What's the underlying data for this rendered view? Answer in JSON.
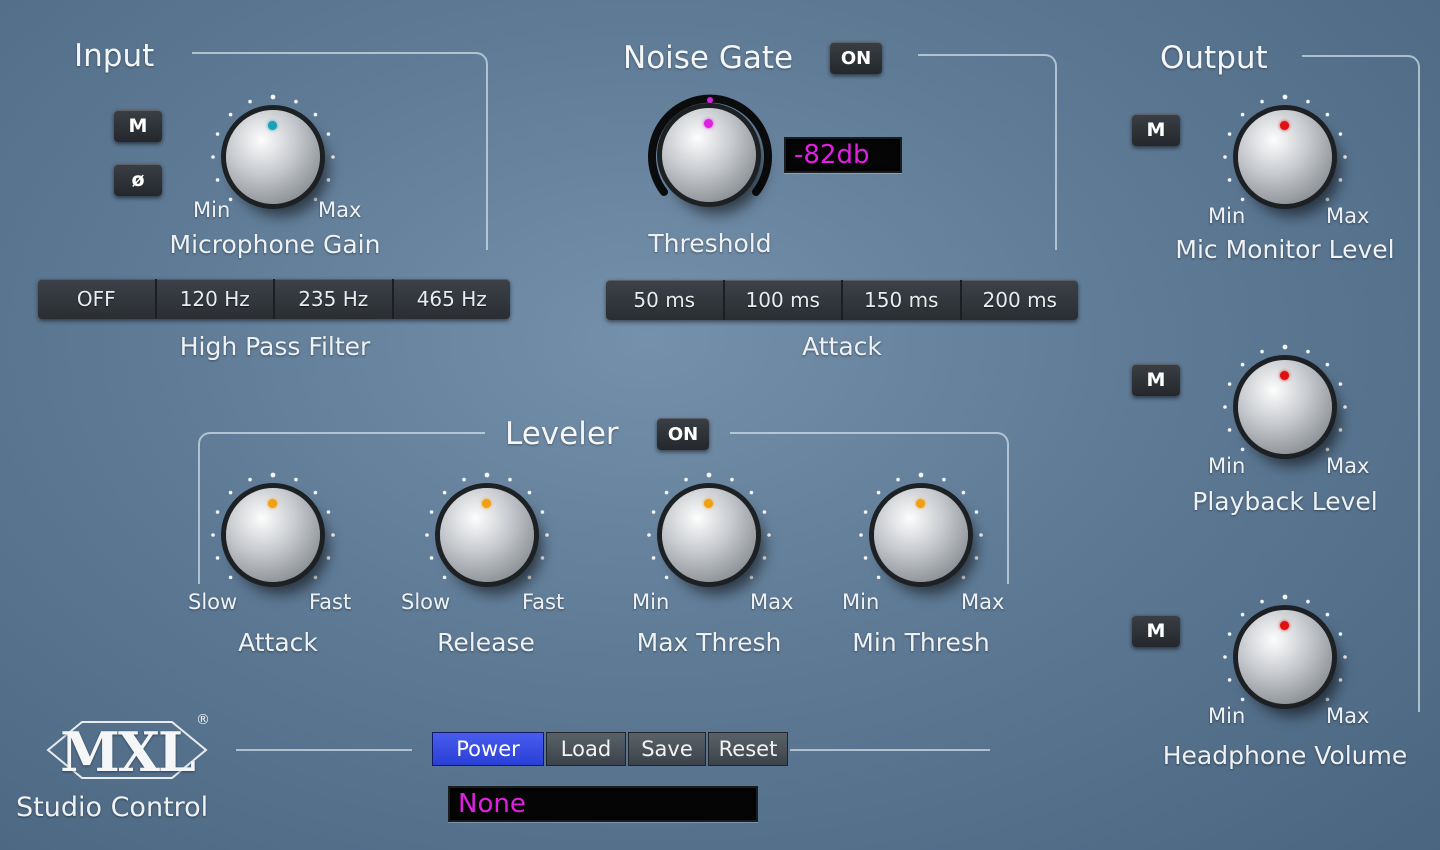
{
  "input": {
    "title": "Input",
    "mute_label": "M",
    "phase_label": "ø",
    "gain": {
      "min_label": "Min",
      "max_label": "Max",
      "label": "Microphone Gain",
      "dot_color": "#1aa0b8"
    },
    "hpf": {
      "options": [
        "OFF",
        "120 Hz",
        "235 Hz",
        "465 Hz"
      ],
      "label": "High Pass Filter"
    }
  },
  "noise_gate": {
    "title": "Noise Gate",
    "on_label": "ON",
    "threshold": {
      "label": "Threshold",
      "value": "-82db",
      "dot_color": "#e020e0"
    },
    "attack": {
      "options": [
        "50 ms",
        "100 ms",
        "150 ms",
        "200 ms"
      ],
      "label": "Attack"
    }
  },
  "output": {
    "title": "Output",
    "mute_label": "M",
    "knobs": [
      {
        "min_label": "Min",
        "max_label": "Max",
        "label": "Mic Monitor Level",
        "dot_color": "#e01010"
      },
      {
        "min_label": "Min",
        "max_label": "Max",
        "label": "Playback Level",
        "dot_color": "#e01010"
      },
      {
        "min_label": "Min",
        "max_label": "Max",
        "label": "Headphone Volume",
        "dot_color": "#e01010"
      }
    ]
  },
  "leveler": {
    "title": "Leveler",
    "on_label": "ON",
    "knobs": [
      {
        "min_label": "Slow",
        "max_label": "Fast",
        "label": "Attack",
        "dot_color": "#f0a010"
      },
      {
        "min_label": "Slow",
        "max_label": "Fast",
        "label": "Release",
        "dot_color": "#f0a010"
      },
      {
        "min_label": "Min",
        "max_label": "Max",
        "label": "Max Thresh",
        "dot_color": "#f0a010"
      },
      {
        "min_label": "Min",
        "max_label": "Max",
        "label": "Min Thresh",
        "dot_color": "#f0a010"
      }
    ]
  },
  "footer": {
    "brand": "MXL",
    "registered": "®",
    "product": "Studio Control",
    "buttons": {
      "power": "Power",
      "load": "Load",
      "save": "Save",
      "reset": "Reset"
    },
    "preset_value": "None"
  },
  "colors": {
    "power_button": "#2a3fd6",
    "display_text": "#e020e0"
  }
}
